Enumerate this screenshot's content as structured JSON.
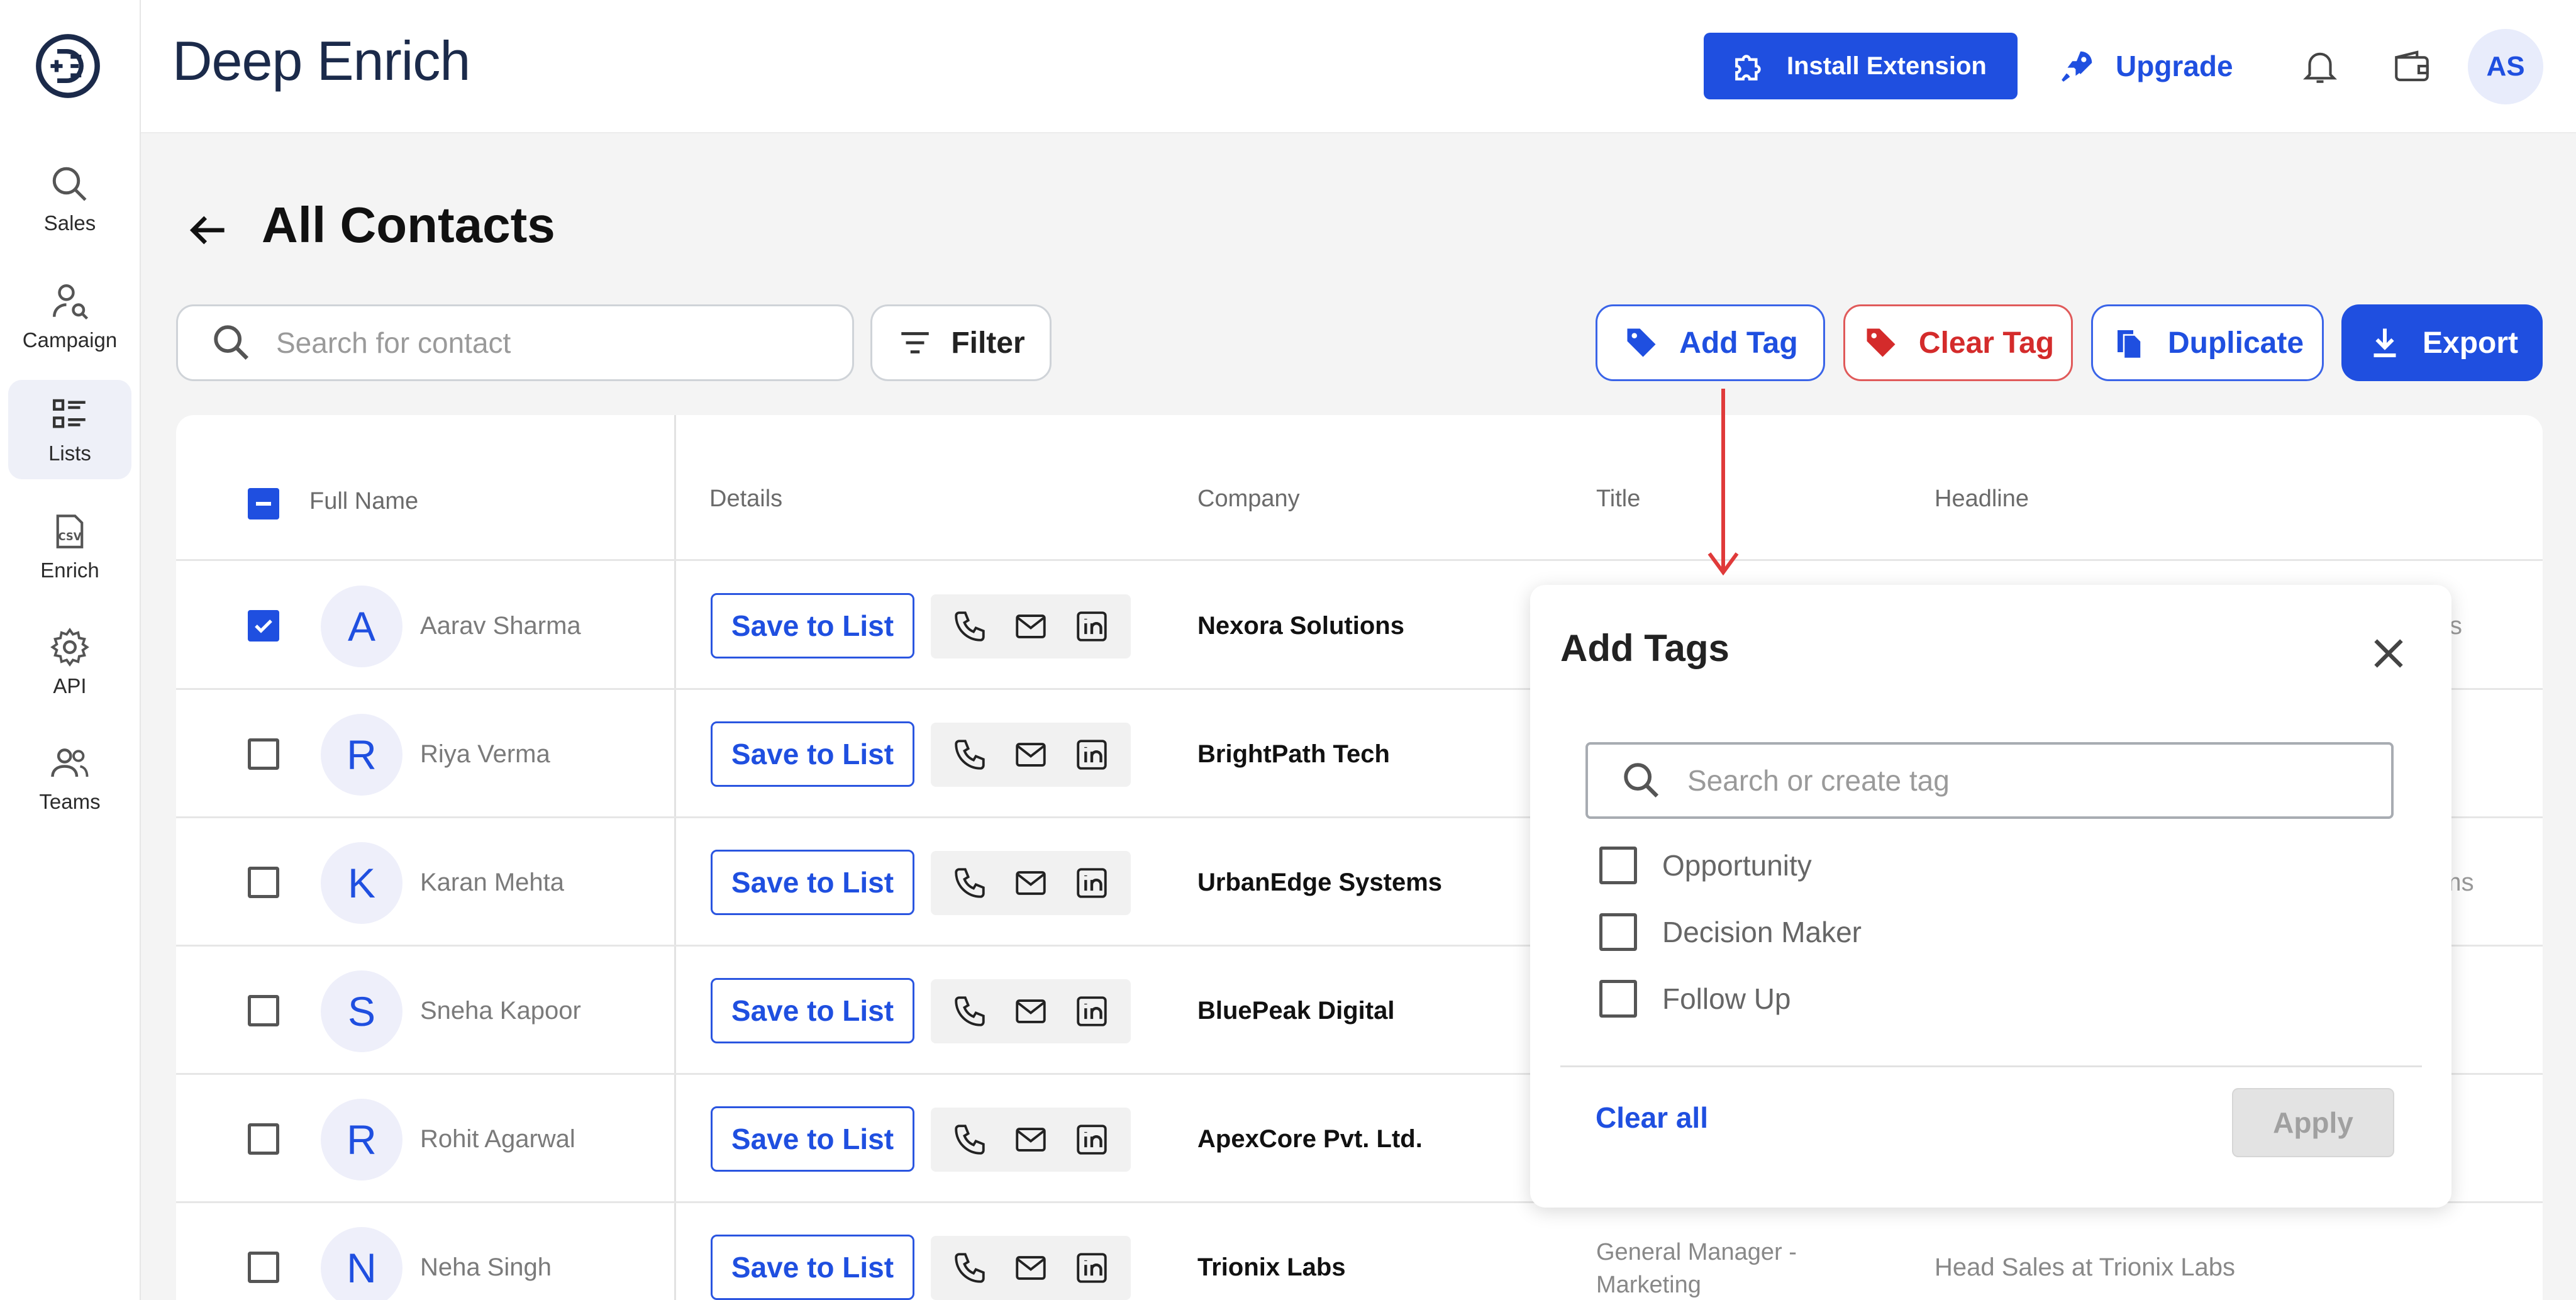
{
  "app": {
    "brand": "Deep Enrich"
  },
  "sidebar": {
    "items": [
      {
        "label": "Sales",
        "icon": "search-icon"
      },
      {
        "label": "Campaign",
        "icon": "campaign-icon"
      },
      {
        "label": "Lists",
        "icon": "lists-icon",
        "active": true
      },
      {
        "label": "Enrich",
        "icon": "csv-file-icon"
      },
      {
        "label": "API",
        "icon": "gear-icon"
      },
      {
        "label": "Teams",
        "icon": "users-icon"
      }
    ]
  },
  "topbar": {
    "install_label": "Install Extension",
    "upgrade_label": "Upgrade",
    "avatar_initials": "AS"
  },
  "page": {
    "title": "All Contacts"
  },
  "toolbar": {
    "search_placeholder": "Search for contact",
    "filter_label": "Filter",
    "add_tag_label": "Add Tag",
    "clear_tag_label": "Clear Tag",
    "duplicate_label": "Duplicate",
    "export_label": "Export"
  },
  "table": {
    "columns": [
      "Full Name",
      "Details",
      "Company",
      "Title",
      "Headline"
    ],
    "save_label": "Save to List",
    "rows": [
      {
        "initial": "A",
        "name": "Aarav Sharma",
        "company": "Nexora Solutions",
        "title": "",
        "headline": "",
        "trailing": "s",
        "checked": true
      },
      {
        "initial": "R",
        "name": "Riya Verma",
        "company": "BrightPath Tech",
        "title": "",
        "headline": "",
        "trailing": "",
        "checked": false
      },
      {
        "initial": "K",
        "name": "Karan Mehta",
        "company": "UrbanEdge Systems",
        "title": "",
        "headline": "",
        "trailing": "ems",
        "checked": false
      },
      {
        "initial": "S",
        "name": "Sneha Kapoor",
        "company": "BluePeak Digital",
        "title": "",
        "headline": "",
        "trailing": "",
        "checked": false
      },
      {
        "initial": "R",
        "name": "Rohit Agarwal",
        "company": "ApexCore Pvt. Ltd.",
        "title": "",
        "headline": "",
        "trailing": "",
        "checked": false
      },
      {
        "initial": "N",
        "name": "Neha Singh",
        "company": "Trionix Labs",
        "title": "General Manager - Marketing",
        "headline": "Head Sales at Trionix Labs",
        "trailing": "",
        "checked": false
      }
    ]
  },
  "modal": {
    "title": "Add Tags",
    "search_placeholder": "Search or create tag",
    "options": [
      "Opportunity",
      "Decision Maker",
      "Follow Up"
    ],
    "clear_all_label": "Clear all",
    "apply_label": "Apply"
  },
  "colors": {
    "accent": "#1f4fe0",
    "danger": "#d42b2b",
    "arrow": "#e03a3a"
  }
}
